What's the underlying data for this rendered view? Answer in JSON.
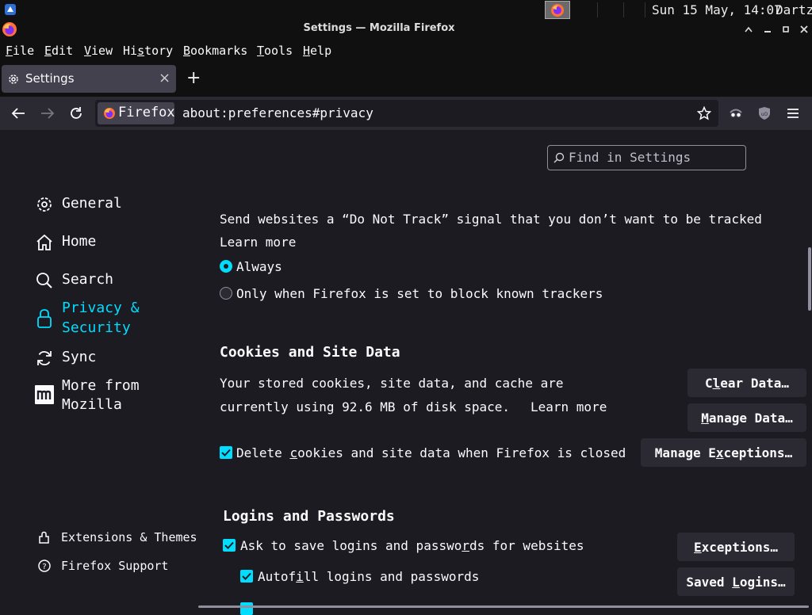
{
  "taskbar": {
    "clock": "Sun 15 May, 14:07",
    "user": "Dartz"
  },
  "window": {
    "title": "Settings — Mozilla Firefox"
  },
  "menu": {
    "file": "File",
    "edit": "Edit",
    "view": "View",
    "history": "History",
    "bookmarks": "Bookmarks",
    "tools": "Tools",
    "help": "Help"
  },
  "tab": {
    "label": "Settings",
    "close": "×",
    "new": "+"
  },
  "urlbar": {
    "identity": "Firefox",
    "url": "about:preferences#privacy"
  },
  "search": {
    "placeholder": "Find in Settings"
  },
  "sidebar": {
    "general": "General",
    "home": "Home",
    "search": "Search",
    "privacy_line1": "Privacy &",
    "privacy_line2": "Security",
    "sync": "Sync",
    "more_line1": "More from",
    "more_line2": "Mozilla",
    "extensions": "Extensions & Themes",
    "support": "Firefox Support"
  },
  "dnt": {
    "text": "Send websites a “Do Not Track” signal that you don’t want to be tracked",
    "learn_more": "Learn more",
    "always": "Always",
    "only_when": "Only when Firefox is set to block known trackers"
  },
  "cookies": {
    "heading": "Cookies and Site Data",
    "line1": "Your stored cookies, site data, and cache are",
    "line2": "currently using 92.6 MB of disk space.",
    "learn_more": "Learn more",
    "clear_data": "Clear Data…",
    "manage_data": "Manage Data…",
    "delete_label": "Delete cookies and site data when Firefox is closed",
    "manage_exceptions": "Manage Exceptions…"
  },
  "logins": {
    "heading": "Logins and Passwords",
    "ask_save": "Ask to save logins and passwords for websites",
    "autofill": "Autofill logins and passwords",
    "exceptions": "Exceptions…",
    "saved_logins": "Saved Logins…"
  },
  "colors": {
    "accent": "#00ddff",
    "background": "#1c1b22",
    "chrome": "#2b2a33",
    "text": "#fbfbfe"
  }
}
